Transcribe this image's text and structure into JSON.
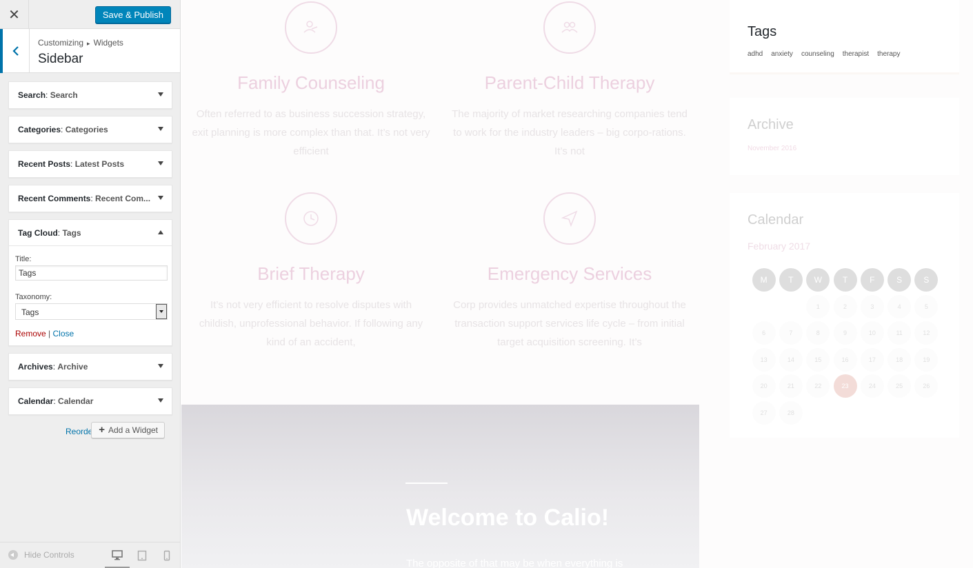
{
  "customizer": {
    "save_label": "Save & Publish",
    "breadcrumb": [
      "Customizing",
      "Widgets"
    ],
    "breadcrumb_sep": "▸",
    "section_title": "Sidebar",
    "widgets": [
      {
        "type": "Search",
        "in": "Search"
      },
      {
        "type": "Categories",
        "in": "Categories"
      },
      {
        "type": "Recent Posts",
        "in": "Latest Posts"
      },
      {
        "type": "Recent Comments",
        "in": "Recent Com..."
      },
      {
        "type": "Tag Cloud",
        "in": "Tags"
      },
      {
        "type": "Archives",
        "in": "Archive"
      },
      {
        "type": "Calendar",
        "in": "Calendar"
      }
    ],
    "tag_cloud_form": {
      "title_label": "Title:",
      "title_value": "Tags",
      "taxonomy_label": "Taxonomy:",
      "taxonomy_value": "Tags",
      "remove_label": "Remove",
      "actions_sep": "|",
      "close_label": "Close"
    },
    "reorder_label": "Reorder",
    "add_widget_label": "Add a Widget",
    "hide_controls_label": "Hide Controls",
    "devices": [
      "desktop-icon",
      "tablet-icon",
      "mobile-icon"
    ]
  },
  "preview": {
    "services": [
      {
        "title": "Family Counseling",
        "text": "Often referred to as business succession strategy, exit planning is more complex than that. It’s not very efficient",
        "icon": "family-icon"
      },
      {
        "title": "Parent-Child Therapy",
        "text": "The majority of market researching companies tend to work for the industry leaders – big corpo-rations. It’s not",
        "icon": "group-icon"
      },
      {
        "title": "Brief Therapy",
        "text": "It’s not very efficient to resolve disputes with childish, unprofessional behavior. If following any kind of an accident,",
        "icon": "clock-icon"
      },
      {
        "title": "Emergency Services",
        "text": "Corp provides unmatched expertise throughout the transaction support services life cycle – from initial target acquisition screening. It’s",
        "icon": "send-icon"
      }
    ],
    "hero": {
      "title": "Welcome to Calio!",
      "subtitle": "The opposite of that may be when everything is"
    },
    "sidebar": {
      "tags_title": "Tags",
      "tags": [
        "adhd",
        "anxiety",
        "counseling",
        "therapist",
        "therapy"
      ],
      "archive_title": "Archive",
      "archive_items": [
        "November 2016"
      ],
      "calendar_title": "Calendar",
      "calendar_month": "February 2017",
      "calendar_days_header": [
        "M",
        "T",
        "W",
        "T",
        "F",
        "S",
        "S"
      ],
      "calendar_weeks": [
        [
          "",
          "",
          "1",
          "2",
          "3",
          "4",
          "5"
        ],
        [
          "6",
          "7",
          "8",
          "9",
          "10",
          "11",
          "12"
        ],
        [
          "13",
          "14",
          "15",
          "16",
          "17",
          "18",
          "19"
        ],
        [
          "20",
          "21",
          "22",
          "23",
          "24",
          "25",
          "26"
        ],
        [
          "27",
          "28",
          "",
          "",
          "",
          "",
          ""
        ]
      ],
      "calendar_today": "23"
    }
  },
  "colors": {
    "accent": "#0085ba",
    "link": "#0073aa",
    "remove": "#aa0000",
    "service_title": "#ecd0df"
  }
}
